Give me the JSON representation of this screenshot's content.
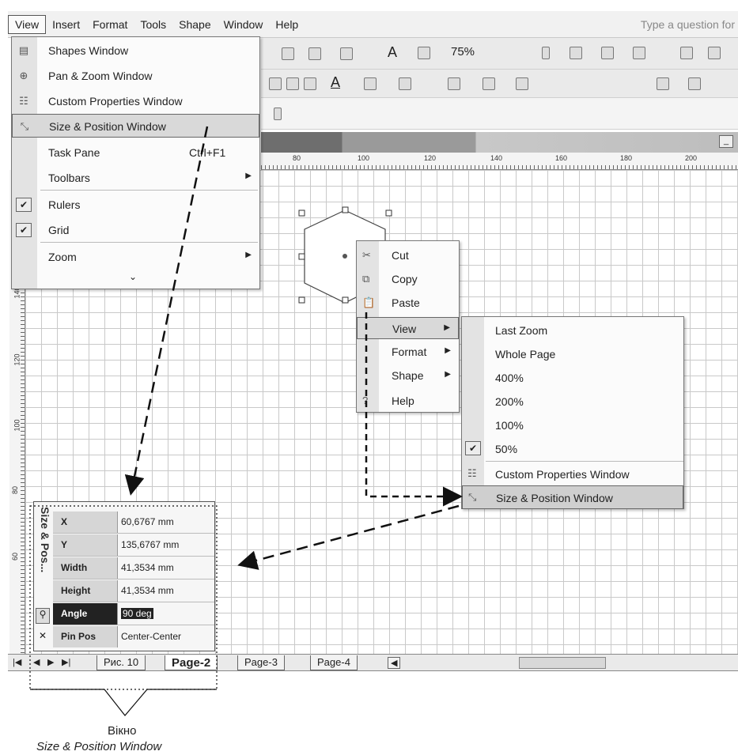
{
  "menubar": {
    "items": [
      "View",
      "Insert",
      "Format",
      "Tools",
      "Shape",
      "Window",
      "Help"
    ],
    "question_placeholder": "Type a question for"
  },
  "toolbar": {
    "zoom": "75%"
  },
  "ruler": {
    "h_ticks": [
      "80",
      "100",
      "120",
      "140",
      "160",
      "180",
      "200"
    ],
    "v_ticks": [
      "140",
      "120",
      "100",
      "80",
      "60"
    ]
  },
  "view_menu": {
    "items": [
      {
        "label": "Shapes Window",
        "icon": "shapes-window-icon"
      },
      {
        "label": "Pan & Zoom Window",
        "icon": "pan-zoom-icon"
      },
      {
        "label": "Custom Properties Window",
        "icon": "custom-properties-icon"
      },
      {
        "label": "Size & Position Window",
        "icon": "size-position-icon"
      },
      {
        "label": "Task Pane",
        "shortcut": "Ctrl+F1"
      },
      {
        "label": "Toolbars"
      },
      {
        "label": "Rulers",
        "checked": true
      },
      {
        "label": "Grid",
        "checked": true
      },
      {
        "label": "Zoom"
      }
    ]
  },
  "context_menu": {
    "items": [
      {
        "label": "Cut",
        "icon": "scissors-icon"
      },
      {
        "label": "Copy",
        "icon": "copy-icon"
      },
      {
        "label": "Paste",
        "icon": "paste-icon"
      },
      {
        "label": "View"
      },
      {
        "label": "Format"
      },
      {
        "label": "Shape"
      },
      {
        "label": "Help",
        "icon": "help-icon"
      }
    ]
  },
  "view_submenu": {
    "items": [
      {
        "label": "Last Zoom"
      },
      {
        "label": "Whole Page"
      },
      {
        "label": "400%"
      },
      {
        "label": "200%"
      },
      {
        "label": "100%"
      },
      {
        "label": "50%",
        "checked": true
      },
      {
        "label": "Custom Properties Window",
        "icon": "custom-properties-icon"
      },
      {
        "label": "Size & Position Window",
        "icon": "size-position-icon"
      }
    ]
  },
  "size_position": {
    "title": "Size & Pos...",
    "rows": [
      {
        "key": "X",
        "value": "60,6767 mm"
      },
      {
        "key": "Y",
        "value": "135,6767 mm"
      },
      {
        "key": "Width",
        "value": "41,3534 mm"
      },
      {
        "key": "Height",
        "value": "41,3534 mm"
      },
      {
        "key": "Angle",
        "value": "90 deg"
      },
      {
        "key": "Pin Pos",
        "value": "Center-Center"
      }
    ]
  },
  "tabs": [
    "Рис. 10",
    "Page-2",
    "Page-3",
    "Page-4"
  ],
  "caption": {
    "line1": "Вікно",
    "line2": "Size & Position Window"
  }
}
